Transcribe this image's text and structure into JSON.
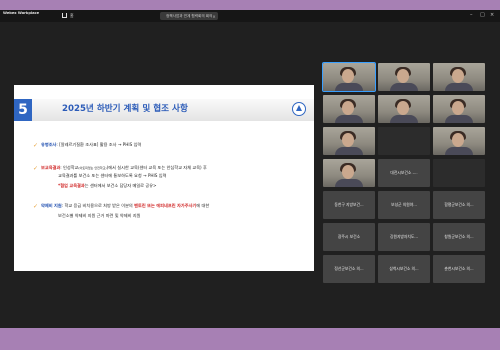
{
  "app": {
    "name": "Webex Workplace"
  },
  "topbar": {
    "home_label": "홈",
    "tab_label": "정책사업과 연계 협력회의 회의"
  },
  "slide": {
    "number": "5",
    "title": "2025년 하반기 계획 및 협조 사항",
    "items": [
      {
        "bullet": "✓",
        "head": "유병조사",
        "text": ": [알레르기질환 조사표] 활용 조사 → PHIS 입력"
      },
      {
        "bullet": "✓",
        "head": "보교육결과",
        "pre": ": 인성학교",
        "small": "(아토피없는 안전학교)",
        "mid": "(에서 실시한 교육(센터 교육 또는 안심학교 자체 교육) 후"
      },
      {
        "text": "교육결과를 보건소 또는 센터에 통보하도록 요청 → PHIS 입력"
      },
      {
        "red": "*협업 교육결과",
        "text": "는 센터에서 보건소 담당자 메일로 공유>"
      },
      {
        "bullet": "✓",
        "head": "약제비 지원",
        "text": ": 학교 응급 비치용으로 처방 받은 이분의 ",
        "red": "벤토린 또는 에피네프린 자가주사기",
        "tail": "에 대한"
      },
      {
        "text": "보건소별 약제비 지원 근거 마련 및 약제비 지원"
      }
    ]
  },
  "participants": [
    {
      "name": "",
      "type": "face",
      "active": true
    },
    {
      "name": "",
      "type": "face"
    },
    {
      "name": "",
      "type": "face"
    },
    {
      "name": "",
      "type": "face"
    },
    {
      "name": "",
      "type": "face"
    },
    {
      "name": "",
      "type": "face"
    },
    {
      "name": "",
      "type": "face"
    },
    {
      "name": "",
      "type": "dark"
    },
    {
      "name": "",
      "type": "face"
    },
    {
      "name": "",
      "type": "face"
    },
    {
      "name": "대전시보건소 -...",
      "type": "name"
    },
    {
      "name": "",
      "type": "dark"
    },
    {
      "name": "동천구 지방보건...",
      "type": "name"
    },
    {
      "name": "보성군 의원야...",
      "type": "name"
    },
    {
      "name": "함평군보건소 의...",
      "type": "name"
    },
    {
      "name": "광주시 보건소",
      "type": "name"
    },
    {
      "name": "강원지방자치도...",
      "type": "name"
    },
    {
      "name": "창원군보건소 의...",
      "type": "name"
    },
    {
      "name": "정선군보건소 의...",
      "type": "name"
    },
    {
      "name": "삼척시보건소 의...",
      "type": "name"
    },
    {
      "name": "춘천시보건소 의...",
      "type": "name"
    }
  ]
}
